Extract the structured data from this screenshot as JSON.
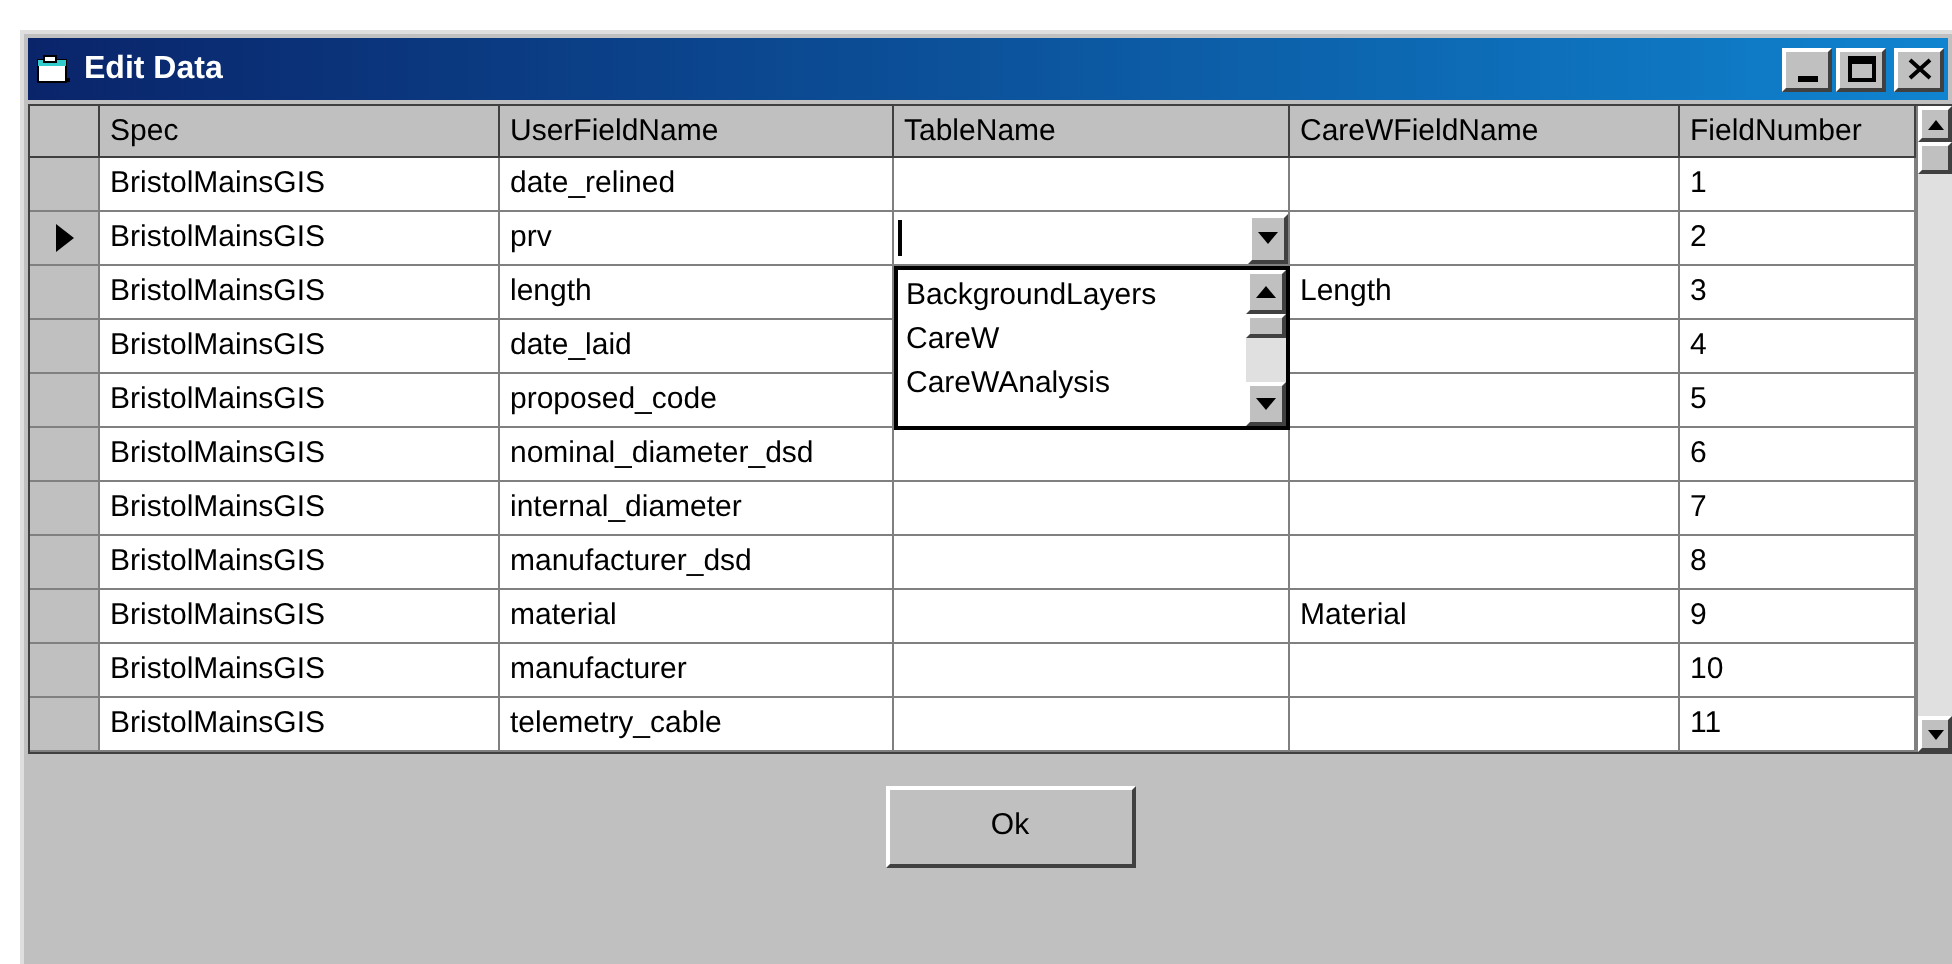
{
  "window": {
    "title": "Edit Data"
  },
  "table": {
    "columns": [
      "Spec",
      "UserFieldName",
      "TableName",
      "CareWFieldName",
      "FieldNumber"
    ],
    "rows": [
      {
        "selected": false,
        "spec": "BristolMainsGIS",
        "user_field_name": "date_relined",
        "field_number": "1"
      },
      {
        "selected": true,
        "spec": "BristolMainsGIS",
        "user_field_name": "prv",
        "table_name_dropdown": {
          "expanded": true,
          "options": [
            "BackgroundLayers",
            "CareW",
            "CareWAnalysis"
          ]
        },
        "field_number": "2"
      },
      {
        "selected": false,
        "spec": "BristolMainsGIS",
        "user_field_name": "length",
        "care_w_field_name": "Length",
        "field_number": "3"
      },
      {
        "selected": false,
        "spec": "BristolMainsGIS",
        "user_field_name": "date_laid",
        "field_number": "4"
      },
      {
        "selected": false,
        "spec": "BristolMainsGIS",
        "user_field_name": "proposed_code",
        "field_number": "5"
      },
      {
        "selected": false,
        "spec": "BristolMainsGIS",
        "user_field_name": "nominal_diameter_dsd",
        "field_number": "6"
      },
      {
        "selected": false,
        "spec": "BristolMainsGIS",
        "user_field_name": "internal_diameter",
        "field_number": "7"
      },
      {
        "selected": false,
        "spec": "BristolMainsGIS",
        "user_field_name": "manufacturer_dsd",
        "field_number": "8"
      },
      {
        "selected": false,
        "spec": "BristolMainsGIS",
        "user_field_name": "material",
        "care_w_field_name": "Material",
        "field_number": "9"
      },
      {
        "selected": false,
        "spec": "BristolMainsGIS",
        "user_field_name": "manufacturer",
        "field_number": "10"
      },
      {
        "selected": false,
        "spec": "BristolMainsGIS",
        "user_field_name": "telemetry_cable",
        "field_number": "11"
      }
    ]
  },
  "buttons": [
    {
      "label": "Ok"
    }
  ]
}
